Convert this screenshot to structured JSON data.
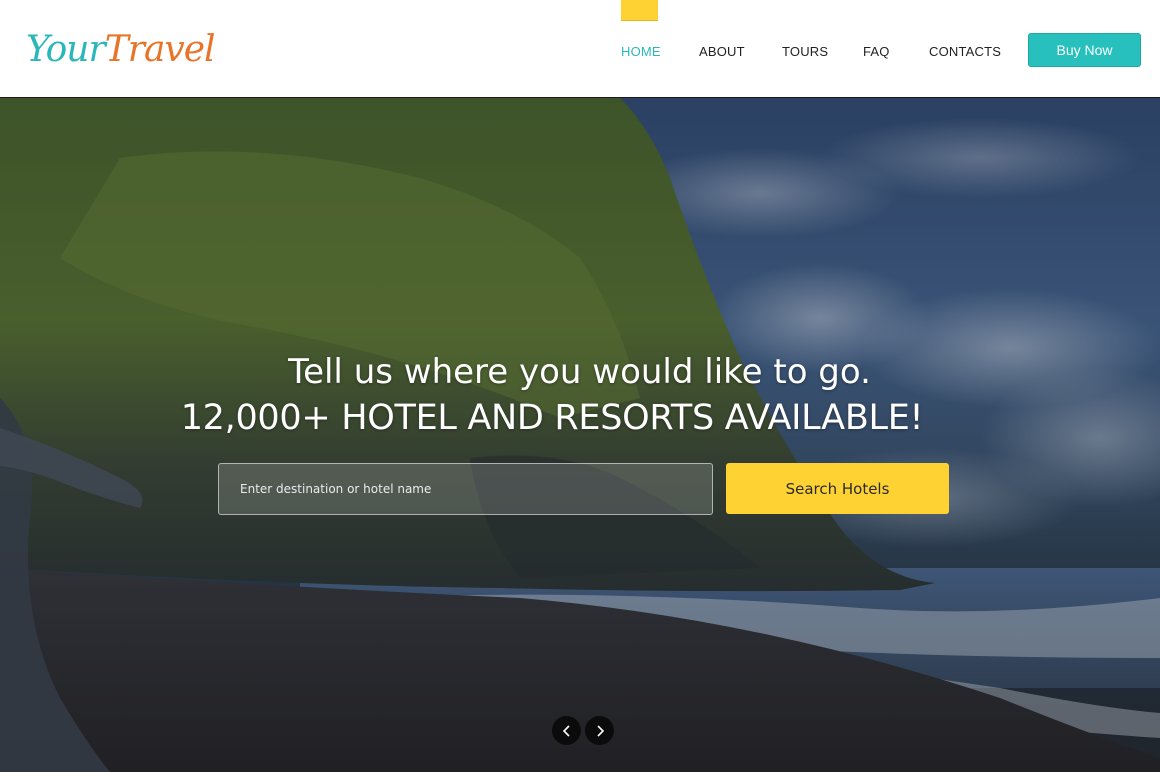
{
  "brand": {
    "logo_part1": "Your",
    "logo_part2": "Travel"
  },
  "nav": {
    "items": [
      {
        "label": "HOME",
        "active": true
      },
      {
        "label": "ABOUT",
        "active": false
      },
      {
        "label": "TOURS",
        "active": false
      },
      {
        "label": "FAQ",
        "active": false
      },
      {
        "label": "CONTACTS",
        "active": false
      }
    ],
    "cta_label": "Buy Now"
  },
  "hero": {
    "headline_line1": "Tell us where you would like to go.",
    "headline_line2": "12,000+ HOTEL AND RESORTS AVAILABLE!",
    "search_placeholder": "Enter destination or hotel name",
    "search_button": "Search Hotels",
    "slider_prev_icon": "chevron-left-icon",
    "slider_next_icon": "chevron-right-icon"
  },
  "colors": {
    "accent_teal": "#27c0bd",
    "accent_yellow": "#ffd233",
    "logo_orange": "#e8742a"
  }
}
